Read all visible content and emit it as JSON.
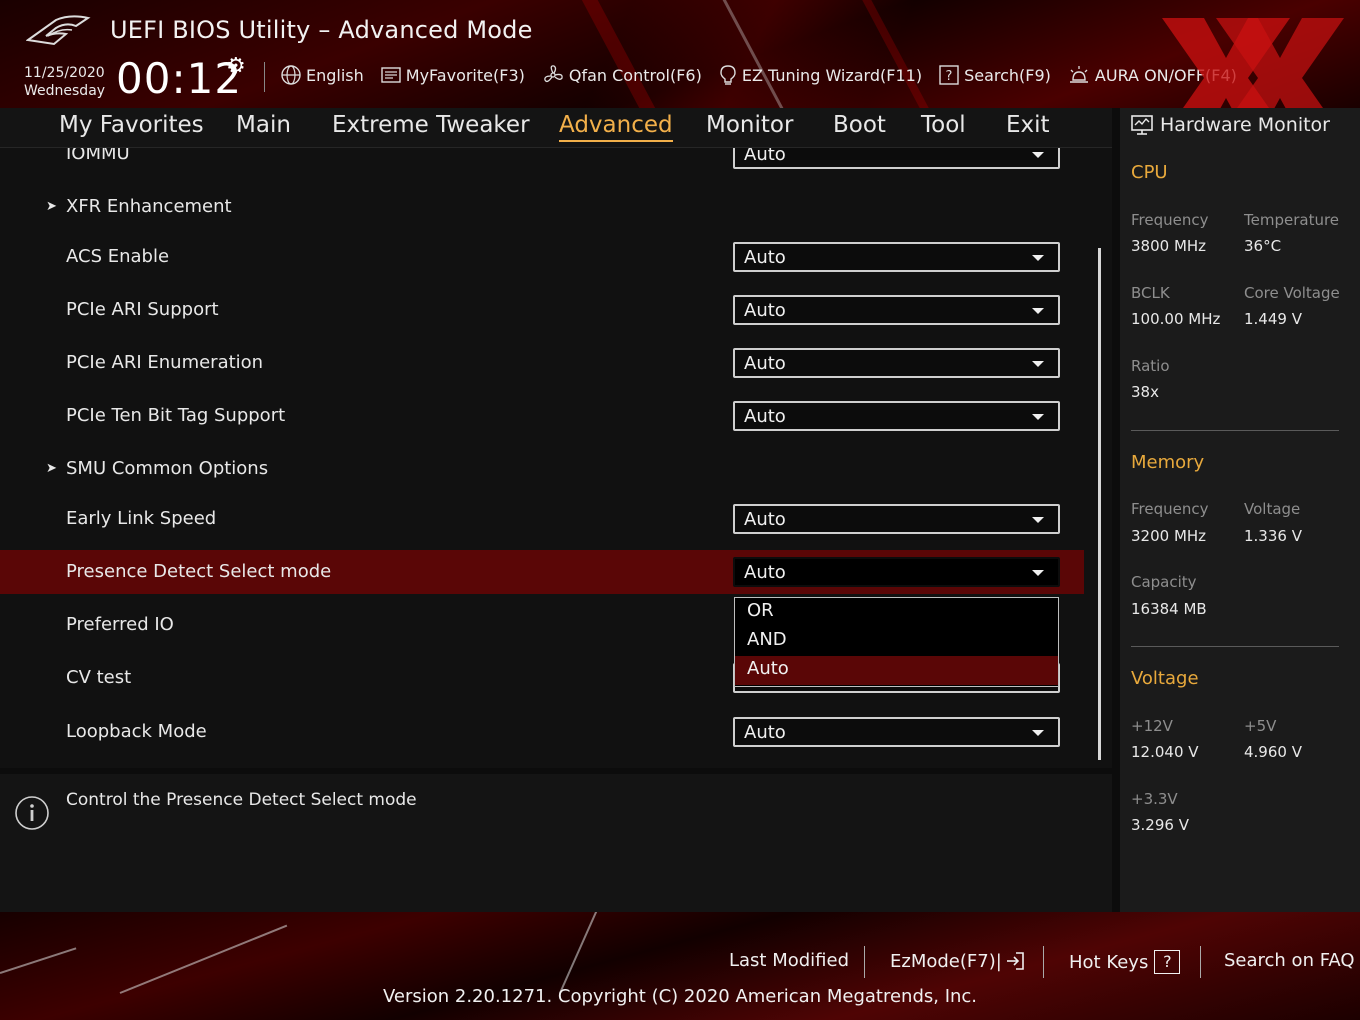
{
  "header": {
    "title": "UEFI BIOS Utility – Advanced Mode",
    "date": "11/25/2020",
    "weekday": "Wednesday",
    "time": "00:12",
    "toolbar": {
      "language": "English",
      "favorite": "MyFavorite(F3)",
      "qfan": "Qfan Control(F6)",
      "ez_tuning": "EZ Tuning Wizard(F11)",
      "search": "Search(F9)",
      "aura": "AURA ON/OFF(F4)"
    }
  },
  "nav": {
    "tabs": [
      "My Favorites",
      "Main",
      "Extreme Tweaker",
      "Advanced",
      "Monitor",
      "Boot",
      "Tool",
      "Exit"
    ],
    "active": "Advanced"
  },
  "settings": {
    "partial_top": {
      "label": "IOMMU",
      "value": "Auto"
    },
    "xfr": {
      "label": "XFR Enhancement"
    },
    "acs": {
      "label": "ACS Enable",
      "value": "Auto"
    },
    "ari_support": {
      "label": "PCIe ARI Support",
      "value": "Auto"
    },
    "ari_enum": {
      "label": "PCIe ARI Enumeration",
      "value": "Auto"
    },
    "ten_bit": {
      "label": "PCIe Ten Bit Tag Support",
      "value": "Auto"
    },
    "smu": {
      "label": "SMU Common Options"
    },
    "early_link": {
      "label": "Early Link Speed",
      "value": "Auto"
    },
    "presence": {
      "label": "Presence Detect Select mode",
      "value": "Auto"
    },
    "preferred_io": {
      "label": "Preferred IO"
    },
    "cv_test": {
      "label": "CV test"
    },
    "loopback": {
      "label": "Loopback Mode",
      "value": "Auto"
    }
  },
  "dropdown": {
    "options": [
      "OR",
      "AND",
      "Auto"
    ],
    "selected": "Auto"
  },
  "help": {
    "text": "Control the Presence Detect Select mode"
  },
  "hardware_monitor": {
    "title": "Hardware Monitor",
    "cpu": {
      "heading": "CPU",
      "frequency_label": "Frequency",
      "frequency": "3800 MHz",
      "temperature_label": "Temperature",
      "temperature": "36°C",
      "bclk_label": "BCLK",
      "bclk": "100.00 MHz",
      "core_voltage_label": "Core Voltage",
      "core_voltage": "1.449 V",
      "ratio_label": "Ratio",
      "ratio": "38x"
    },
    "memory": {
      "heading": "Memory",
      "frequency_label": "Frequency",
      "frequency": "3200 MHz",
      "voltage_label": "Voltage",
      "voltage": "1.336 V",
      "capacity_label": "Capacity",
      "capacity": "16384 MB"
    },
    "voltage": {
      "heading": "Voltage",
      "v12_label": "+12V",
      "v12": "12.040 V",
      "v5_label": "+5V",
      "v5": "4.960 V",
      "v33_label": "+3.3V",
      "v33": "3.296 V"
    }
  },
  "footer": {
    "last_modified": "Last Modified",
    "ezmode": "EzMode(F7)|",
    "hotkeys": "Hot Keys",
    "hotkeys_key": "?",
    "faq": "Search on FAQ",
    "version": "Version 2.20.1271. Copyright (C) 2020 American Megatrends, Inc."
  },
  "colors": {
    "accent": "#f3b04a",
    "highlight": "#5a0606",
    "section_heading": "#e8a93c"
  }
}
